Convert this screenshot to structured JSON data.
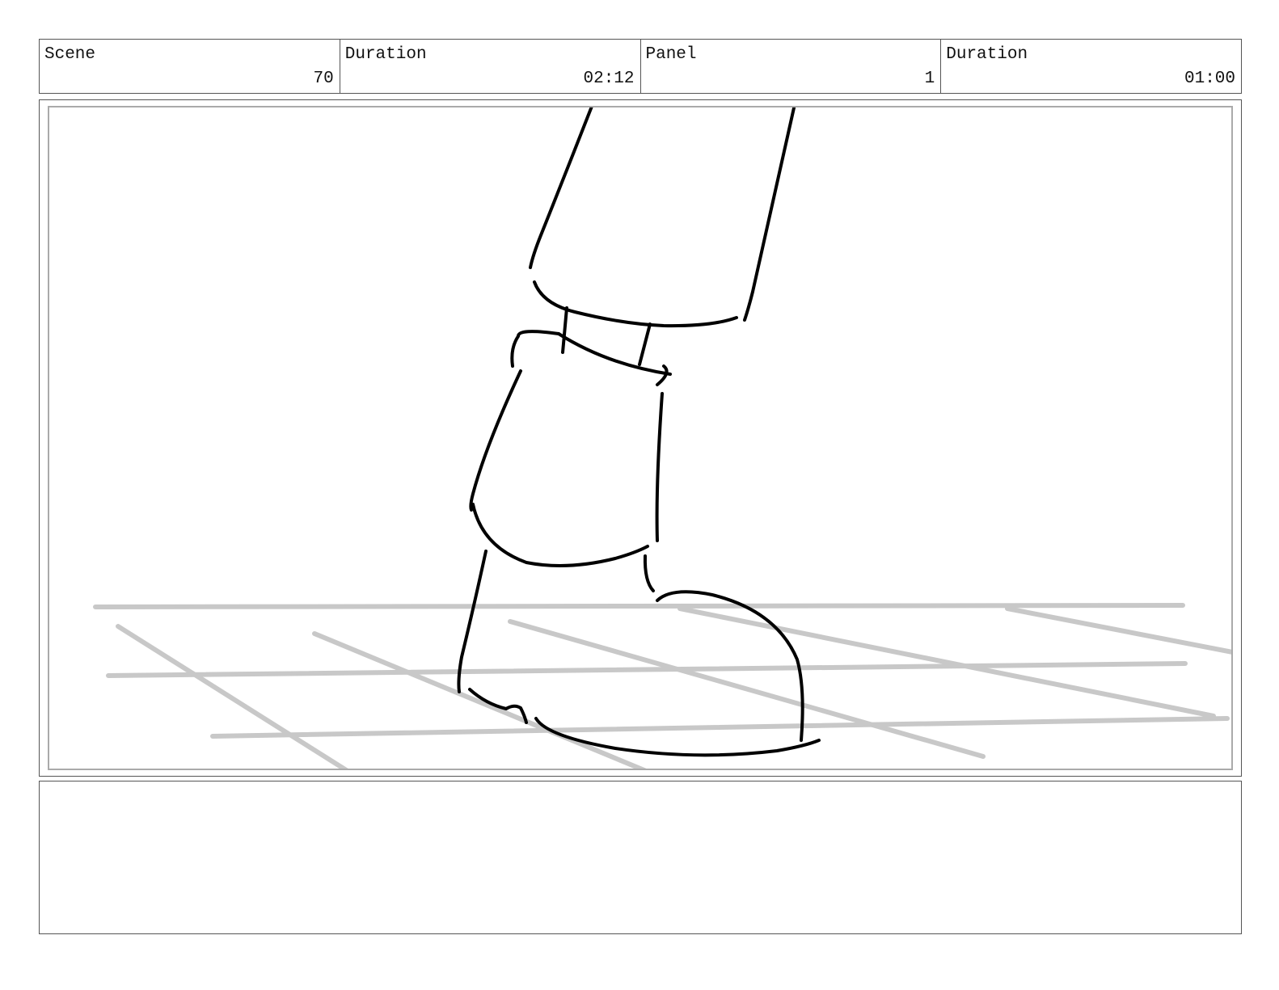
{
  "header": {
    "scene": {
      "label": "Scene",
      "value": "70"
    },
    "scene_duration": {
      "label": "Duration",
      "value": "02:12"
    },
    "panel": {
      "label": "Panel",
      "value": "1"
    },
    "panel_duration": {
      "label": "Duration",
      "value": "01:00"
    }
  },
  "panel_image": {
    "sketch_color": "#000000",
    "floor_grid_color": "#c8c8c8"
  },
  "notes": {
    "text": ""
  }
}
